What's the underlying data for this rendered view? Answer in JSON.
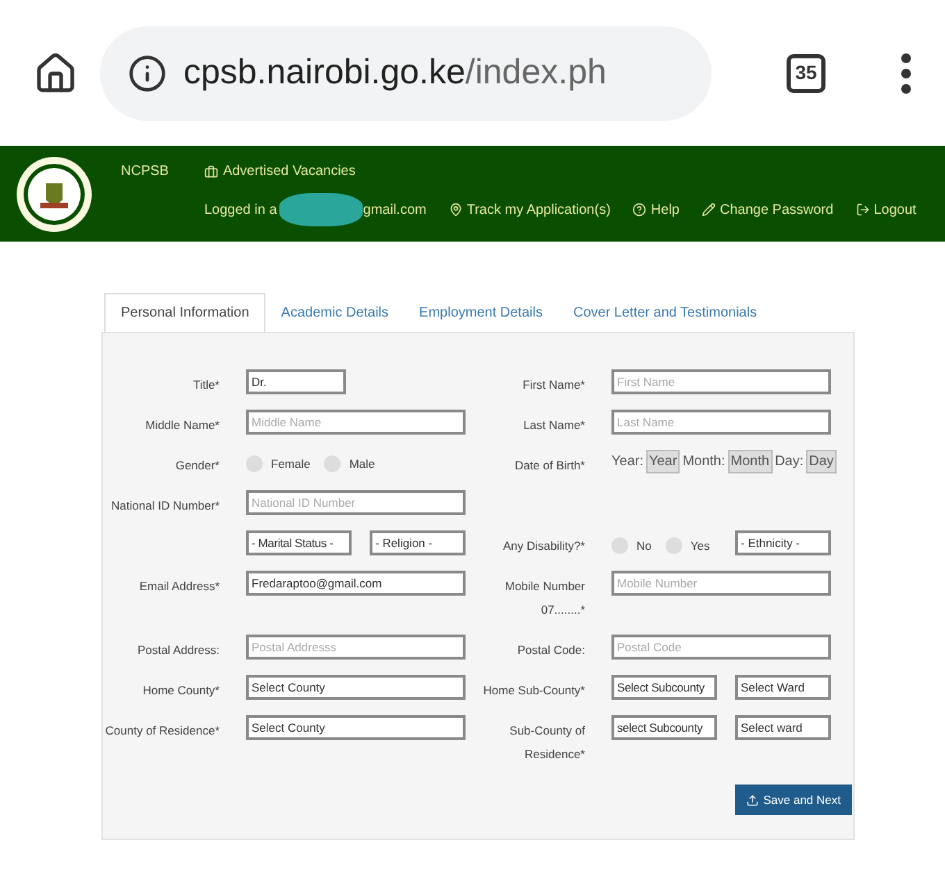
{
  "browser": {
    "url_host": "cpsb.nairobi.go.ke",
    "url_path": "/index.ph",
    "tab_count": "35"
  },
  "nav": {
    "brand": "NCPSB",
    "vacancies": "Advertised Vacancies",
    "logged_in_prefix": "Logged in a",
    "logged_in_suffix": "gmail.com",
    "links": [
      {
        "kind": "pin",
        "label": "Track my Application(s)"
      },
      {
        "kind": "help",
        "label": "Help"
      },
      {
        "kind": "pencil",
        "label": "Change Password"
      },
      {
        "kind": "logout",
        "label": "Logout"
      }
    ]
  },
  "tabs": [
    {
      "label": "Personal Information",
      "selected": true
    },
    {
      "label": "Academic Details",
      "selected": false
    },
    {
      "label": "Employment Details",
      "selected": false
    },
    {
      "label": "Cover Letter and Testimonials",
      "selected": false
    }
  ],
  "rows": [
    {
      "left": {
        "kind": "short",
        "label": "Title*",
        "value": "Dr."
      },
      "right": {
        "kind": "input",
        "label": "First Name*",
        "placeholder": "First Name"
      }
    },
    {
      "left": {
        "kind": "input",
        "label": "Middle Name*",
        "placeholder": "Middle Name"
      },
      "right": {
        "kind": "input",
        "label": "Last Name*",
        "placeholder": "Last Name"
      }
    },
    {
      "left": {
        "kind": "radio",
        "label": "Gender*",
        "options": [
          {
            "label": "Female",
            "selected": false
          },
          {
            "label": "Male",
            "selected": false
          }
        ]
      },
      "right": {
        "kind": "dob",
        "label": "Date of Birth*",
        "parts": [
          {
            "label": "Year:",
            "value": "Year"
          },
          {
            "label": "Month:",
            "value": "Month"
          },
          {
            "label": "Day:",
            "value": "Day"
          }
        ]
      }
    },
    {
      "left": {
        "kind": "input",
        "label": "National ID Number*",
        "placeholder": "National ID Number"
      }
    },
    {
      "left": {
        "kind": "selects",
        "options": [
          "- Marital Status -",
          "- Religion -"
        ]
      },
      "right": {
        "kind": "radio-select",
        "label": "Any Disability?*",
        "options": [
          {
            "label": "No",
            "selected": false
          },
          {
            "label": "Yes",
            "selected": false
          }
        ],
        "select": "- Ethnicity -"
      }
    },
    {
      "left": {
        "kind": "input",
        "label": "Email Address*",
        "value": "Fredaraptoo@gmail.com"
      },
      "right": {
        "kind": "input",
        "label": "Mobile Number 07........*",
        "placeholder": "Mobile Number"
      }
    },
    {
      "left": {
        "kind": "input",
        "label": "Postal Address:",
        "placeholder": "Postal Addresss"
      },
      "right": {
        "kind": "input",
        "label": "Postal Code:",
        "placeholder": "Postal Code"
      }
    },
    {
      "left": {
        "kind": "select",
        "label": "Home County*",
        "value": "Select County"
      },
      "right": {
        "kind": "selects",
        "label": "Home Sub-County*",
        "options": [
          "Select Subcounty",
          "Select Ward"
        ]
      }
    },
    {
      "left": {
        "kind": "select",
        "label": "County of Residence*",
        "value": "Select County"
      },
      "right": {
        "kind": "selects",
        "label": "Sub-County of Residence*",
        "options": [
          "select Subcounty",
          "Select ward"
        ]
      }
    }
  ],
  "save_button": "Save and Next"
}
